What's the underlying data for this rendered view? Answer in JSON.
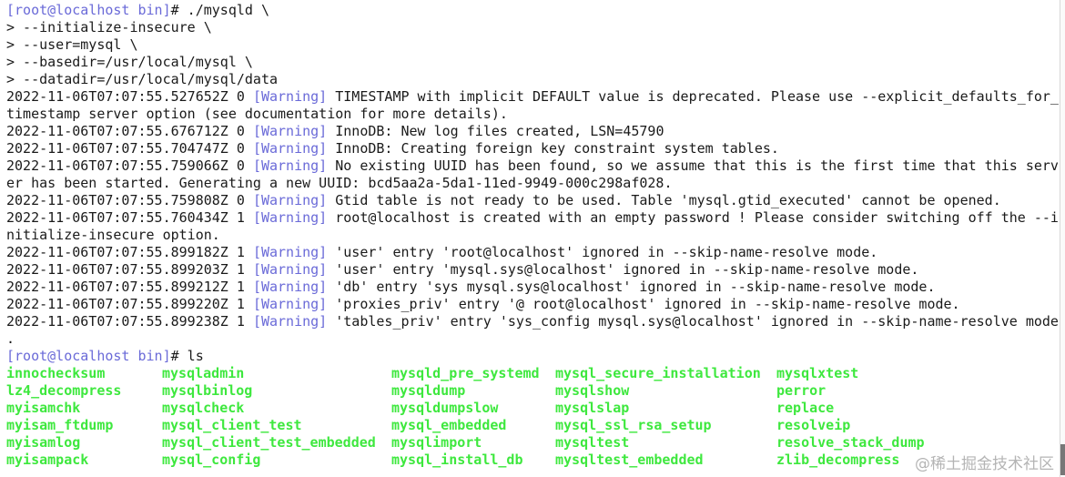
{
  "terminal": {
    "lines": [
      {
        "prompt": "[root@localhost bin]",
        "text": "# ./mysqld \\"
      },
      {
        "text": "> --initialize-insecure \\"
      },
      {
        "text": "> --user=mysql \\"
      },
      {
        "text": "> --basedir=/usr/local/mysql \\"
      },
      {
        "text": "> --datadir=/usr/local/mysql/data"
      },
      {
        "prefix": "2022-11-06T07:07:55.527652Z 0 ",
        "tag": "[Warning]",
        "text": " TIMESTAMP with implicit DEFAULT value is deprecated. Please use --explicit_defaults_for_"
      },
      {
        "text": "timestamp server option (see documentation for more details)."
      },
      {
        "prefix": "2022-11-06T07:07:55.676712Z 0 ",
        "tag": "[Warning]",
        "text": " InnoDB: New log files created, LSN=45790"
      },
      {
        "prefix": "2022-11-06T07:07:55.704747Z 0 ",
        "tag": "[Warning]",
        "text": " InnoDB: Creating foreign key constraint system tables."
      },
      {
        "prefix": "2022-11-06T07:07:55.759066Z 0 ",
        "tag": "[Warning]",
        "text": " No existing UUID has been found, so we assume that this is the first time that this serv"
      },
      {
        "text": "er has been started. Generating a new UUID: bcd5aa2a-5da1-11ed-9949-000c298af028."
      },
      {
        "prefix": "2022-11-06T07:07:55.759808Z 0 ",
        "tag": "[Warning]",
        "text": " Gtid table is not ready to be used. Table 'mysql.gtid_executed' cannot be opened."
      },
      {
        "prefix": "2022-11-06T07:07:55.760434Z 1 ",
        "tag": "[Warning]",
        "text": " root@localhost is created with an empty password ! Please consider switching off the --i"
      },
      {
        "text": "nitialize-insecure option."
      },
      {
        "prefix": "2022-11-06T07:07:55.899182Z 1 ",
        "tag": "[Warning]",
        "text": " 'user' entry 'root@localhost' ignored in --skip-name-resolve mode."
      },
      {
        "prefix": "2022-11-06T07:07:55.899203Z 1 ",
        "tag": "[Warning]",
        "text": " 'user' entry 'mysql.sys@localhost' ignored in --skip-name-resolve mode."
      },
      {
        "prefix": "2022-11-06T07:07:55.899212Z 1 ",
        "tag": "[Warning]",
        "text": " 'db' entry 'sys mysql.sys@localhost' ignored in --skip-name-resolve mode."
      },
      {
        "prefix": "2022-11-06T07:07:55.899220Z 1 ",
        "tag": "[Warning]",
        "text": " 'proxies_priv' entry '@ root@localhost' ignored in --skip-name-resolve mode."
      },
      {
        "prefix": "2022-11-06T07:07:55.899238Z 1 ",
        "tag": "[Warning]",
        "text": " 'tables_priv' entry 'sys_config mysql.sys@localhost' ignored in --skip-name-resolve mode"
      },
      {
        "text": "."
      },
      {
        "prompt": "[root@localhost bin]",
        "text": "# ls"
      }
    ],
    "ls_rows": [
      [
        "innochecksum",
        "mysqladmin",
        "mysqld_pre_systemd",
        "mysql_secure_installation",
        "mysqlxtest"
      ],
      [
        "lz4_decompress",
        "mysqlbinlog",
        "mysqldump",
        "mysqlshow",
        "perror"
      ],
      [
        "myisamchk",
        "mysqlcheck",
        "mysqldumpslow",
        "mysqlslap",
        "replace"
      ],
      [
        "myisam_ftdump",
        "mysql_client_test",
        "mysql_embedded",
        "mysql_ssl_rsa_setup",
        "resolveip"
      ],
      [
        "myisamlog",
        "mysql_client_test_embedded",
        "mysqlimport",
        "mysqltest",
        "resolve_stack_dump"
      ],
      [
        "myisampack",
        "mysql_config",
        "mysql_install_db",
        "mysqltest_embedded",
        "zlib_decompress"
      ]
    ]
  },
  "watermark": "@稀土掘金技术社区",
  "colors": {
    "prompt": "#6a6ad8",
    "executable": "#3ee83e",
    "text": "#1a1a1a"
  }
}
